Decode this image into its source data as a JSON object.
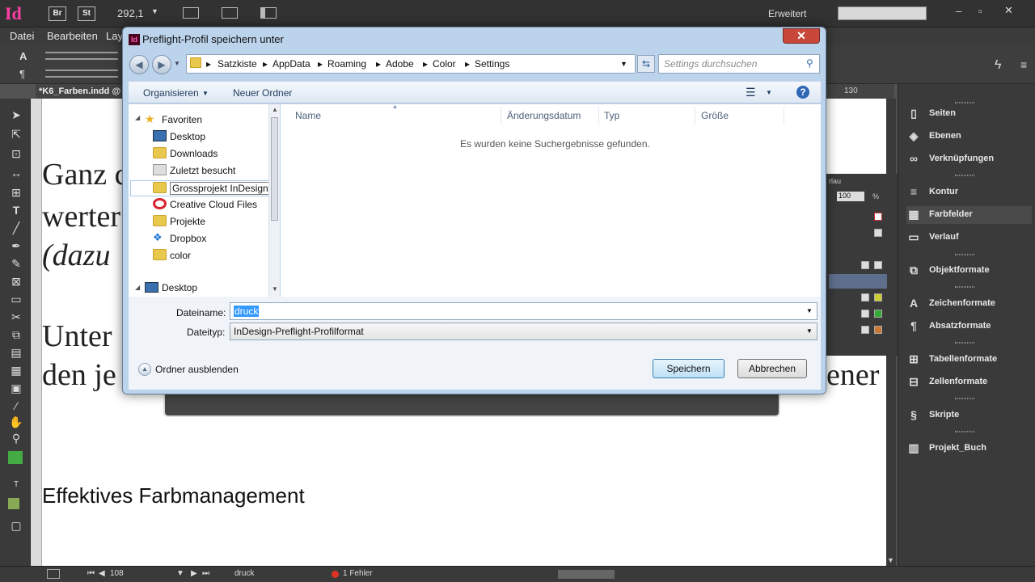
{
  "app": {
    "logo": "Id",
    "bridge_label": "Br",
    "stock_label": "St",
    "zoom_value": "292,1",
    "workspace_label": "Erweitert"
  },
  "menu": {
    "items": [
      "Datei",
      "Bearbeiten",
      "Lay"
    ]
  },
  "document": {
    "tab_label": "*K6_Farben.indd @",
    "ruler_mark": "130",
    "lines": [
      "Ganz c",
      "werter",
      "(dazu",
      "Unter",
      "den je"
    ],
    "right_fragment_1": "ener",
    "heading": "Effektives Farbmanagement"
  },
  "right_panel": {
    "items": [
      {
        "icon": "pages-icon",
        "label": "Seiten"
      },
      {
        "icon": "layers-icon",
        "label": "Ebenen"
      },
      {
        "icon": "links-icon",
        "label": "Verknüpfungen"
      },
      {
        "icon": "stroke-icon",
        "label": "Kontur"
      },
      {
        "icon": "swatches-icon",
        "label": "Farbfelder"
      },
      {
        "icon": "gradient-icon",
        "label": "Verlauf"
      },
      {
        "icon": "object-styles-icon",
        "label": "Objektformate"
      },
      {
        "icon": "character-styles-icon",
        "label": "Zeichenformate"
      },
      {
        "icon": "paragraph-styles-icon",
        "label": "Absatzformate"
      },
      {
        "icon": "table-styles-icon",
        "label": "Tabellenformate"
      },
      {
        "icon": "cell-styles-icon",
        "label": "Zellenformate"
      },
      {
        "icon": "scripts-icon",
        "label": "Skripte"
      },
      {
        "icon": "book-icon",
        "label": "Projekt_Buch"
      }
    ]
  },
  "swatch_panel": {
    "tab_fragment": "rlau",
    "tint_value": "100",
    "tint_unit": "%"
  },
  "status": {
    "page": "108",
    "profile": "druck",
    "errors": "1 Fehler"
  },
  "dialog": {
    "title": "Preflight-Profil speichern unter",
    "close_label": "✕",
    "breadcrumb": [
      "Satzkiste",
      "AppData",
      "Roaming",
      "Adobe",
      "Color",
      "Settings"
    ],
    "search_placeholder": "Settings durchsuchen",
    "organize_label": "Organisieren",
    "new_folder_label": "Neuer Ordner",
    "nav": {
      "favorites_label": "Favoriten",
      "items": [
        "Desktop",
        "Downloads",
        "Zuletzt besucht",
        "Grossprojekt InDesign",
        "Creative Cloud Files",
        "Projekte",
        "Dropbox",
        "color"
      ],
      "desktop_root": "Desktop"
    },
    "columns": [
      "Name",
      "Änderungsdatum",
      "Typ",
      "Größe"
    ],
    "empty_message": "Es wurden keine Suchergebnisse gefunden.",
    "filename_label": "Dateiname:",
    "filename_value": "druck",
    "filetype_label": "Dateityp:",
    "filetype_value": "InDesign-Preflight-Profilformat",
    "hide_folders_label": "Ordner ausblenden",
    "save_label": "Speichern",
    "cancel_label": "Abbrechen"
  }
}
